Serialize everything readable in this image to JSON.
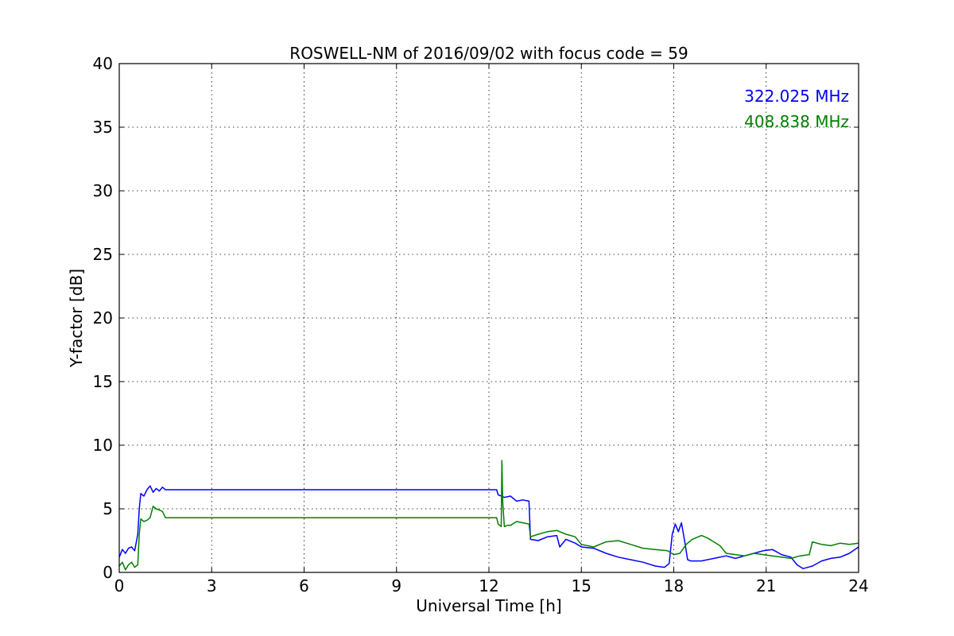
{
  "chart_data": {
    "type": "line",
    "title": "ROSWELL-NM of 2016/09/02 with focus code = 59",
    "xlabel": "Universal Time [h]",
    "ylabel": "Y-factor [dB]",
    "xlim": [
      0,
      24
    ],
    "ylim": [
      0,
      40
    ],
    "xticks": [
      0,
      3,
      6,
      9,
      12,
      15,
      18,
      21,
      24
    ],
    "yticks": [
      0,
      5,
      10,
      15,
      20,
      25,
      30,
      35,
      40
    ],
    "grid": true,
    "legend_position": "top-right",
    "series": [
      {
        "name": "322.025 MHz",
        "color": "#0000ff",
        "x": [
          0.0,
          0.1,
          0.2,
          0.3,
          0.4,
          0.5,
          0.6,
          0.65,
          0.7,
          0.8,
          0.9,
          1.0,
          1.1,
          1.2,
          1.3,
          1.4,
          1.5,
          12.25,
          12.3,
          12.5,
          12.7,
          12.9,
          13.1,
          13.3,
          13.35,
          13.6,
          13.9,
          14.2,
          14.3,
          14.5,
          14.8,
          15.0,
          15.4,
          15.8,
          16.2,
          16.6,
          17.0,
          17.4,
          17.7,
          17.85,
          17.95,
          18.05,
          18.15,
          18.25,
          18.35,
          18.45,
          18.55,
          18.9,
          19.3,
          19.7,
          20.0,
          20.3,
          20.6,
          20.9,
          21.2,
          21.5,
          21.8,
          22.0,
          22.2,
          22.5,
          22.8,
          23.1,
          23.4,
          23.7,
          24.0
        ],
        "y": [
          1.2,
          1.8,
          1.5,
          1.9,
          2.0,
          1.7,
          3.0,
          5.0,
          6.2,
          6.0,
          6.5,
          6.8,
          6.3,
          6.6,
          6.4,
          6.7,
          6.5,
          6.5,
          6.1,
          5.9,
          6.0,
          5.6,
          5.7,
          5.6,
          2.6,
          2.5,
          2.8,
          2.9,
          2.0,
          2.6,
          2.3,
          2.0,
          1.9,
          1.5,
          1.2,
          1.0,
          0.8,
          0.5,
          0.4,
          0.7,
          3.0,
          3.8,
          3.2,
          3.9,
          2.5,
          1.0,
          0.9,
          0.9,
          1.1,
          1.3,
          1.1,
          1.3,
          1.5,
          1.7,
          1.8,
          1.4,
          1.2,
          0.6,
          0.3,
          0.5,
          0.9,
          1.1,
          1.2,
          1.5,
          2.0
        ]
      },
      {
        "name": "408.838 MHz",
        "color": "#008000",
        "x": [
          0.0,
          0.1,
          0.2,
          0.3,
          0.4,
          0.5,
          0.6,
          0.65,
          0.7,
          0.8,
          0.9,
          1.0,
          1.1,
          1.2,
          1.3,
          1.4,
          1.5,
          12.25,
          12.3,
          12.4,
          12.42,
          12.45,
          12.5,
          12.6,
          12.7,
          12.9,
          13.1,
          13.3,
          13.35,
          13.6,
          13.9,
          14.2,
          14.5,
          14.8,
          15.0,
          15.4,
          15.8,
          16.2,
          16.6,
          17.0,
          17.4,
          17.8,
          18.0,
          18.2,
          18.4,
          18.6,
          18.9,
          19.1,
          19.3,
          19.5,
          19.7,
          20.0,
          20.3,
          20.6,
          20.9,
          21.2,
          21.5,
          21.8,
          22.1,
          22.4,
          22.5,
          22.8,
          23.1,
          23.4,
          23.7,
          24.0
        ],
        "y": [
          0.5,
          0.8,
          0.2,
          0.6,
          0.8,
          0.4,
          0.6,
          3.0,
          4.2,
          4.0,
          4.1,
          4.3,
          5.2,
          5.0,
          4.9,
          4.8,
          4.3,
          4.3,
          3.8,
          3.6,
          8.8,
          5.5,
          3.6,
          3.7,
          3.7,
          4.0,
          3.9,
          3.8,
          2.8,
          3.0,
          3.2,
          3.3,
          3.0,
          2.8,
          2.2,
          2.0,
          2.4,
          2.5,
          2.2,
          1.9,
          1.8,
          1.7,
          1.4,
          1.5,
          2.2,
          2.6,
          2.9,
          2.7,
          2.4,
          2.1,
          1.5,
          1.4,
          1.3,
          1.5,
          1.4,
          1.3,
          1.2,
          1.1,
          1.3,
          1.4,
          2.4,
          2.2,
          2.1,
          2.3,
          2.2,
          2.3
        ]
      }
    ]
  }
}
